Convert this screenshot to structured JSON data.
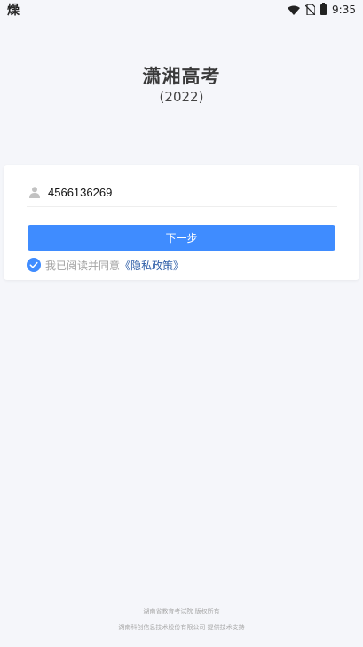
{
  "status_bar": {
    "app_icon_glyph": "燥",
    "time": "9:35",
    "icons": [
      "wifi-icon",
      "no-sim-icon",
      "battery-icon"
    ]
  },
  "header": {
    "title": "潇湘高考",
    "year": "(2022)"
  },
  "form": {
    "phone_value": "4566136269",
    "user_icon": "user-icon",
    "next_label": "下一步",
    "agree_prefix": "我已阅读并同意",
    "policy_link": "《隐私政策》",
    "agreed": true
  },
  "footer": {
    "line1": "湖南省教育考试院 版权所有",
    "line2": "湖南科创信息技术股份有限公司 提供技术支持"
  },
  "colors": {
    "primary": "#3f8cff",
    "link": "#2e5ea8",
    "background": "#f5f6fa"
  }
}
